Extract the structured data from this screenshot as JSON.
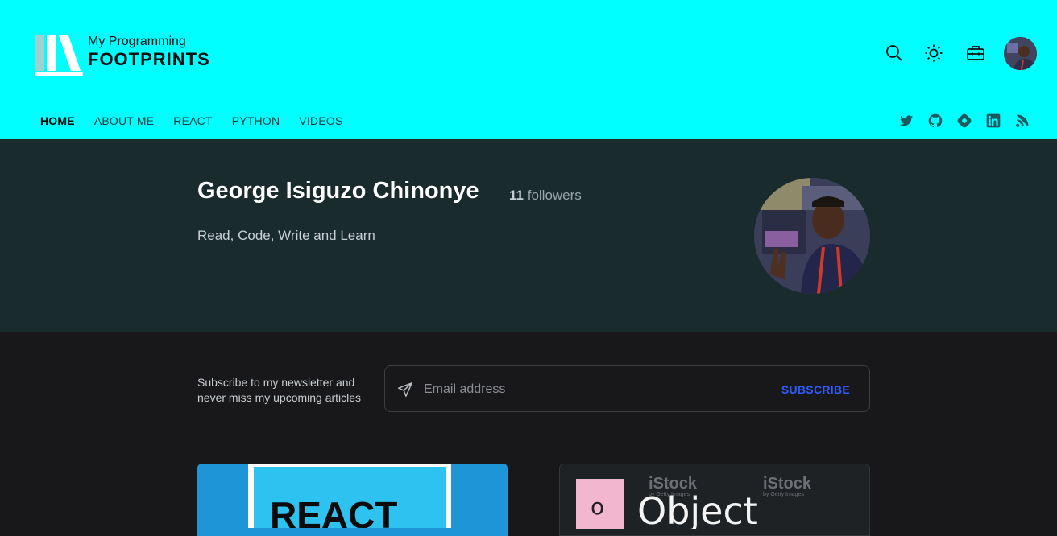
{
  "header": {
    "logo": {
      "line1": "My Programming",
      "line2": "FOOTPRINTS"
    },
    "actions": [
      {
        "name": "search-icon"
      },
      {
        "name": "sun-icon"
      },
      {
        "name": "toolbox-icon"
      },
      {
        "name": "user-avatar"
      }
    ],
    "nav": [
      {
        "label": "HOME",
        "active": true
      },
      {
        "label": "ABOUT ME"
      },
      {
        "label": "REACT"
      },
      {
        "label": "PYTHON"
      },
      {
        "label": "VIDEOS"
      }
    ],
    "social": [
      "twitter-icon",
      "github-icon",
      "hashnode-icon",
      "linkedin-icon",
      "rss-icon"
    ]
  },
  "hero": {
    "name": "George Isiguzo Chinonye",
    "followers_count": "11",
    "followers_label": "followers",
    "tagline": "Read, Code, Write and Learn"
  },
  "newsletter": {
    "text": "Subscribe to my newsletter and never miss my upcoming articles",
    "placeholder": "Email address",
    "button": "SUBSCRIBE"
  },
  "cards": [
    {
      "image_text": "REACT"
    },
    {
      "image_text_left": "o",
      "image_text_right": "Object",
      "watermark": "iStock",
      "watermark_sub": "by Getty Images"
    }
  ],
  "colors": {
    "header_bg": "#00ffff",
    "hero_bg": "#1a2b2e",
    "page_bg": "#18181b",
    "accent": "#2f5bff"
  }
}
